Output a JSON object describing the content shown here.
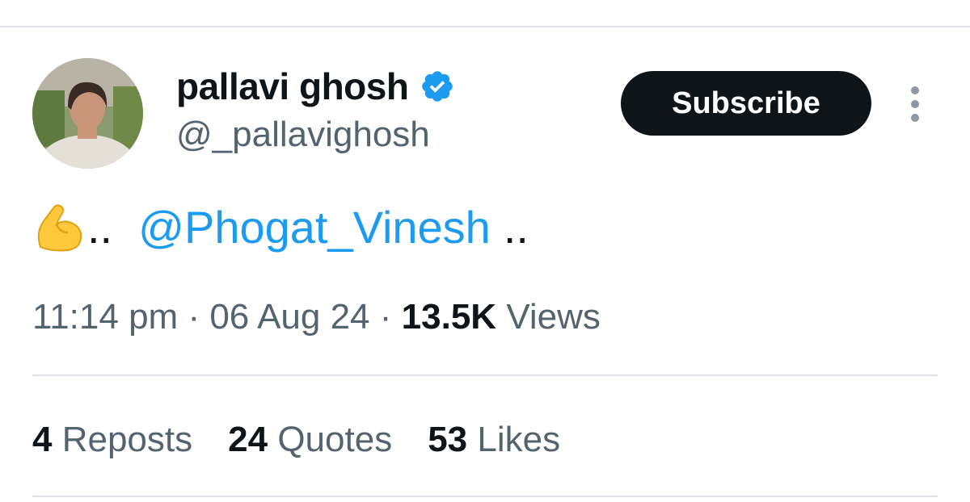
{
  "profile": {
    "display_name": "pallavi ghosh",
    "handle": "@_pallavighosh",
    "verified_icon": "verified-badge-icon"
  },
  "actions": {
    "subscribe_label": "Subscribe",
    "more_icon": "more-vertical-icon"
  },
  "tweet": {
    "emoji_icon": "flexed-biceps-icon",
    "text_before": "..",
    "mention": "@Phogat_Vinesh",
    "text_after": ".."
  },
  "meta": {
    "time": "11:14 pm",
    "separator": "·",
    "date": "06 Aug 24",
    "views_count": "13.5K",
    "views_label": "Views"
  },
  "stats": {
    "reposts_count": "4",
    "reposts_label": "Reposts",
    "quotes_count": "24",
    "quotes_label": "Quotes",
    "likes_count": "53",
    "likes_label": "Likes"
  },
  "colors": {
    "accent": "#1d9bf0",
    "text_primary": "#0f1419",
    "text_secondary": "#536471",
    "divider": "#dde2e6"
  }
}
